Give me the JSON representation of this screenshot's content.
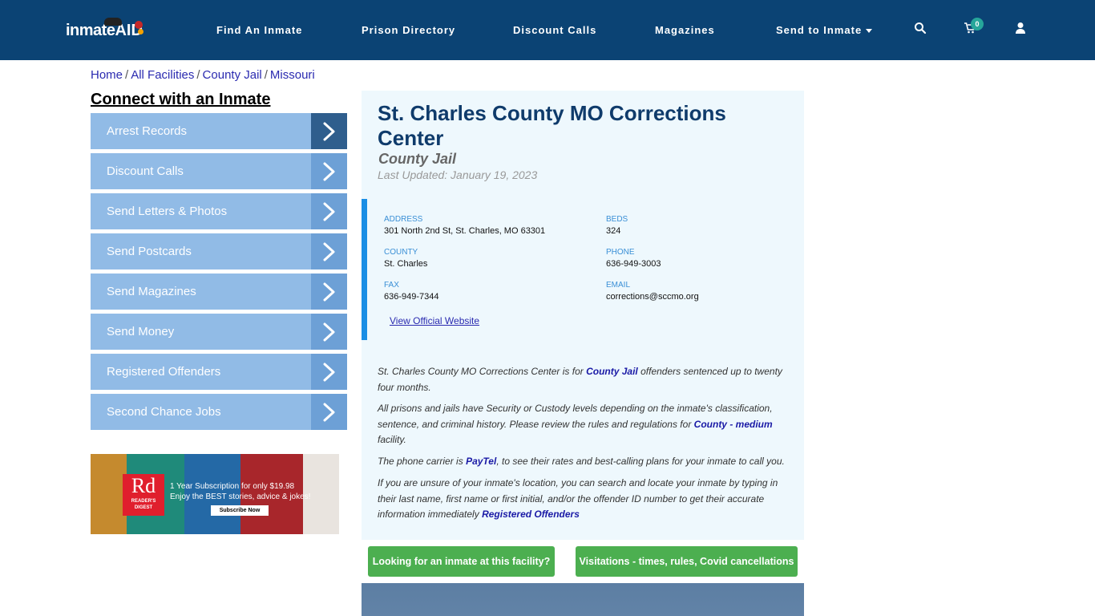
{
  "nav": {
    "logo_text": "inmate",
    "logo_accent": "AID",
    "items": [
      {
        "label": "Find An Inmate"
      },
      {
        "label": "Prison Directory"
      },
      {
        "label": "Discount Calls"
      },
      {
        "label": "Magazines"
      },
      {
        "label": "Send to Inmate"
      }
    ],
    "icons": {
      "search": "search-icon",
      "cart": "cart-icon",
      "user": "user-icon"
    },
    "cart_count": "0"
  },
  "breadcrumb": [
    {
      "label": "Home"
    },
    {
      "label": "All Facilities"
    },
    {
      "label": "County Jail"
    },
    {
      "label": "Missouri"
    }
  ],
  "sidebar": {
    "title": "Connect with an Inmate",
    "items": [
      {
        "label": "Arrest Records"
      },
      {
        "label": "Discount Calls"
      },
      {
        "label": "Send Letters & Photos"
      },
      {
        "label": "Send Postcards"
      },
      {
        "label": "Send Magazines"
      },
      {
        "label": "Send Money"
      },
      {
        "label": "Registered Offenders"
      },
      {
        "label": "Second Chance Jobs"
      }
    ]
  },
  "ad": {
    "brand_short": "Rd",
    "brand_name": "READER'S DIGEST",
    "line1": "1 Year Subscription for only $19.98",
    "line2": "Enjoy the BEST stories, advice & jokes!",
    "button": "Subscribe Now"
  },
  "facility": {
    "title": "St. Charles County MO Corrections Center",
    "type": "County Jail",
    "updated": "Last Updated: January 19, 2023",
    "info": {
      "address_label": "ADDRESS",
      "address": "301 North 2nd St, St. Charles, MO 63301",
      "beds_label": "BEDS",
      "beds": "324",
      "county_label": "COUNTY",
      "county": "St. Charles",
      "phone_label": "PHONE",
      "phone": "636-949-3003",
      "fax_label": "FAX",
      "fax": "636-949-7344",
      "email_label": "EMAIL",
      "email": "corrections@sccmo.org",
      "website_link": "View Official Website"
    }
  },
  "description": {
    "p1_a": "St. Charles County MO Corrections Center is for ",
    "p1_link": "County Jail",
    "p1_b": " offenders sentenced up to twenty four months.",
    "p2_a": "All prisons and jails have Security or Custody levels depending on the inmate's classification, sentence, and criminal history. Please review the rules and regulations for ",
    "p2_link": "County - medium",
    "p2_b": " facility.",
    "p3_a": "The phone carrier is ",
    "p3_link": "PayTel",
    "p3_b": ", to see their rates and best-calling plans for your inmate to call you.",
    "p4_a": "If you are unsure of your inmate's location, you can search and locate your inmate by typing in their last name, first name or first initial, and/or the offender ID number to get their accurate information immediately ",
    "p4_link": "Registered Offenders"
  },
  "buttons": {
    "lookup": "Looking for an inmate at this facility?",
    "visitations": "Visitations - times, rules, Covid cancellations"
  }
}
